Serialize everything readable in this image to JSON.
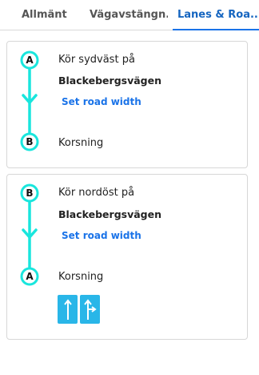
{
  "tabs": [
    "Allmänt",
    "Vägavstängn...",
    "Lanes & Roa..."
  ],
  "active_tab": 2,
  "colors": {
    "route_line": "#19e6dd",
    "link": "#1a73e8",
    "lane_bg": "#29b6e8",
    "active_tab": "#1a73e8"
  },
  "segments": [
    {
      "from": "A",
      "to": "B",
      "direction": "Kör sydväst på",
      "street": "Blackebergsvägen",
      "link": "Set road width",
      "end_text": "Korsning"
    },
    {
      "from": "B",
      "to": "A",
      "direction": "Kör nordöst på",
      "street": "Blackebergsvägen",
      "link": "Set road width",
      "end_text": "Korsning",
      "lane_icons": [
        "straight-arrow-icon",
        "straight-right-arrow-icon"
      ]
    }
  ]
}
